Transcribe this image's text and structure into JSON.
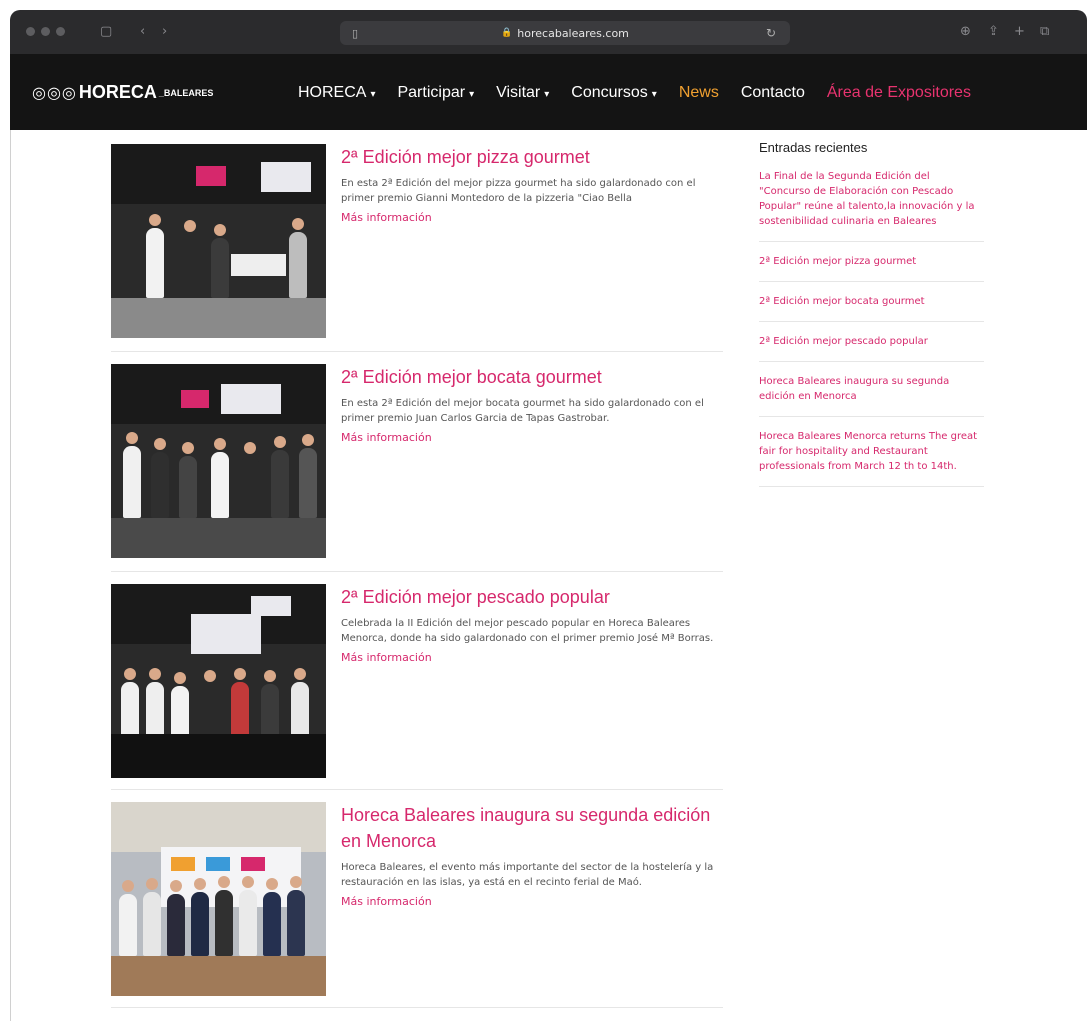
{
  "browser": {
    "url": "horecabaleares.com"
  },
  "nav": {
    "logo_brand": "HORECA",
    "logo_sub": "_BALEARES",
    "items": [
      {
        "label": "HORECA",
        "caret": "▾"
      },
      {
        "label": "Participar",
        "caret": "▾"
      },
      {
        "label": "Visitar",
        "caret": "▾"
      },
      {
        "label": "Concursos",
        "caret": "▾"
      }
    ],
    "news": "News",
    "contact": "Contacto",
    "exhibitors": "Área de Expositores"
  },
  "posts": [
    {
      "title": "2ª Edición mejor pizza gourmet",
      "date": "",
      "text": "En esta 2ª Edición del mejor pizza gourmet ha sido galardonado con el primer premio Gianni Montedoro de la pizzeria \"Ciao Bella",
      "more": "Más información"
    },
    {
      "title": "2ª Edición mejor bocata gourmet",
      "date": "",
      "text": "En esta 2ª Edición del mejor bocata gourmet ha sido galardonado con el primer premio Juan Carlos Garcia de Tapas Gastrobar.",
      "more": "Más información"
    },
    {
      "title": "2ª Edición mejor pescado popular",
      "date": "",
      "text": "Celebrada la II Edición del mejor pescado popular en Horeca Baleares Menorca, donde ha sido galardonado con el primer premio José Mª Borras.",
      "more": "Más información"
    },
    {
      "title": "Horeca Baleares inaugura su segunda edición en Menorca",
      "date": "",
      "text": "Horeca Baleares, el evento más importante del sector de la hostelería y la restauración en las islas, ya está en el recinto ferial de Maó.",
      "more": "Más información"
    }
  ],
  "sidebar": {
    "title": "Entradas recientes",
    "items": [
      "La Final de la Segunda Edición del \"Concurso de Elaboración con Pescado Popular\" reúne al talento,la innovación y la sostenibilidad culinaria en Baleares",
      "2ª Edición mejor pizza gourmet",
      "2ª Edición mejor bocata gourmet",
      "2ª Edición mejor pescado popular",
      "Horeca Baleares inaugura su segunda edición en Menorca",
      "Horeca Baleares Menorca returns The great fair for hospitality and Restaurant professionals from March 12 th to 14th."
    ]
  },
  "colors": {
    "accent": "#d6286c",
    "news": "#f0a030",
    "navbar": "#141414"
  }
}
